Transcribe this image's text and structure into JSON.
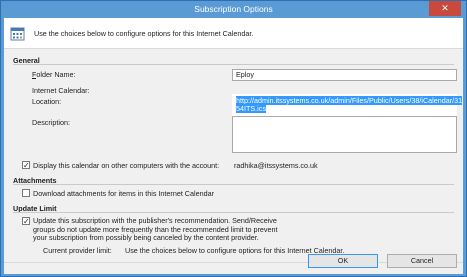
{
  "window": {
    "title": "Subscription Options",
    "close_glyph": "✕"
  },
  "header": {
    "intro": "Use the choices below to configure options for this Internet Calendar.",
    "icon": "calendar-options-icon"
  },
  "general": {
    "section_title": "General",
    "folder_name_label": "Folder Name:",
    "folder_name_value": "Eploy",
    "internet_calendar_label": "Internet Calendar:",
    "location_label": "Location:",
    "location_value_line1": "http://admin.itssystems.co.uk/admin/Files/Public/Users/38/iCalendar/31",
    "location_value_line2": "54ITS.ics",
    "description_label": "Description:",
    "description_value": "",
    "display_checkbox_label": "Display this calendar on other computers with the account:",
    "display_checked": true,
    "account": "radhika@itssystems.co.uk"
  },
  "attachments": {
    "section_title": "Attachments",
    "download_label": "Download attachments for items in this Internet Calendar",
    "download_checked": false
  },
  "update_limit": {
    "section_title": "Update Limit",
    "update_label_line1": "Update this subscription with the publisher's recommendation. Send/Receive",
    "update_label_line2": "groups do not update more frequently than the recommended limit to prevent",
    "update_label_line3": "your subscription from possibly being canceled by the content provider.",
    "update_checked": true,
    "current_limit_label": "Current provider limit:",
    "current_limit_value": "Use the choices below to configure options for this Internet Calendar."
  },
  "buttons": {
    "ok": "OK",
    "cancel": "Cancel"
  },
  "colors": {
    "title_bar": "#5b9bd5",
    "selection": "#3399ff",
    "close": "#c74a3c"
  }
}
